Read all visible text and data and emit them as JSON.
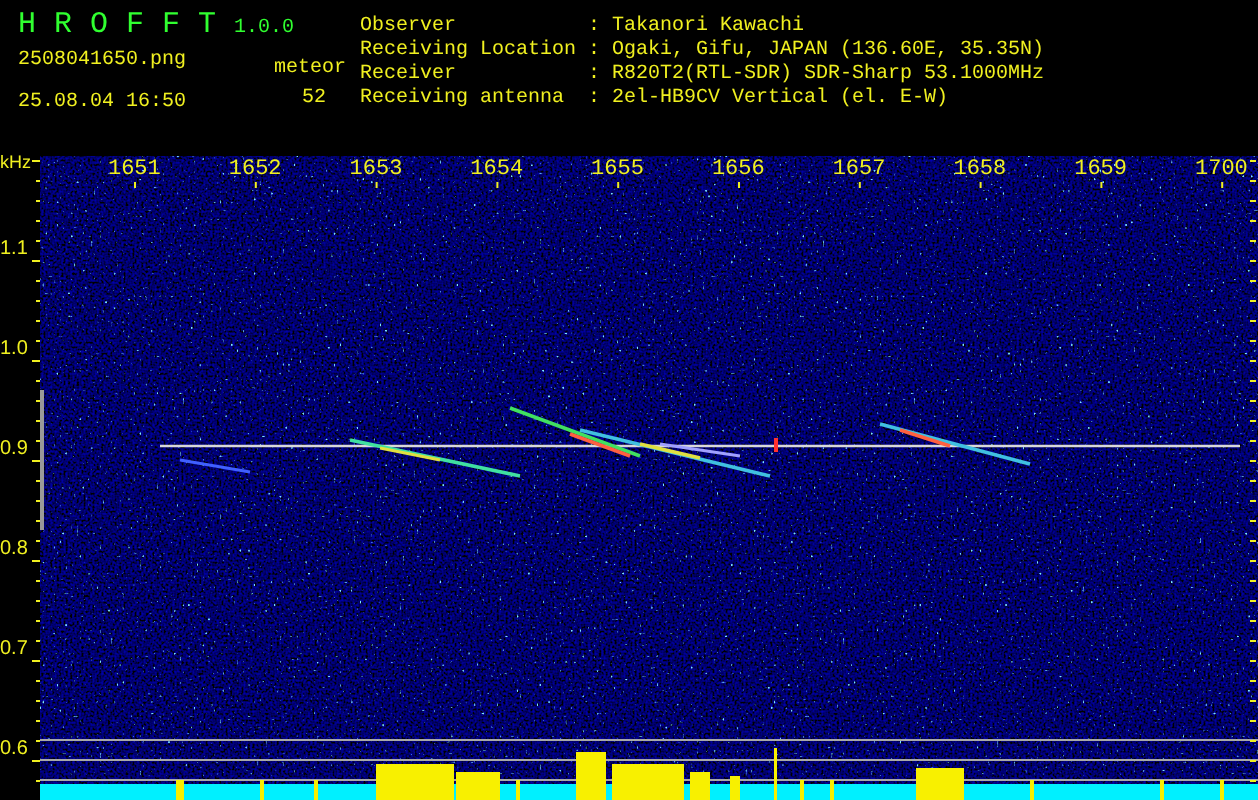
{
  "header": {
    "title": "H R O F F T",
    "version": "1.0.0",
    "filename": "2508041650.png",
    "datetime": "25.08.04 16:50",
    "meteor_label": "meteor",
    "meteor_count": "52",
    "info": [
      {
        "label": "Observer",
        "value": ": Takanori Kawachi"
      },
      {
        "label": "Receiving Location",
        "value": ": Ogaki, Gifu, JAPAN (136.60E, 35.35N)"
      },
      {
        "label": "Receiver",
        "value": ": R820T2(RTL-SDR) SDR-Sharp 53.1000MHz"
      },
      {
        "label": "Receiving antenna",
        "value": ": 2el-HB9CV Vertical (el. E-W)"
      }
    ]
  },
  "plot": {
    "y_unit": "kHz",
    "y_labels": [
      "1.1",
      "1.0",
      "0.9",
      "0.8",
      "0.7",
      "0.6"
    ],
    "x_labels": [
      "1651",
      "1652",
      "1653",
      "1654",
      "1655",
      "1656",
      "1657",
      "1658",
      "1659",
      "1700"
    ]
  }
}
